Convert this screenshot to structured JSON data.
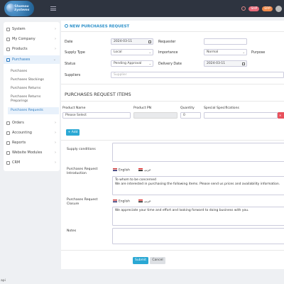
{
  "app": {
    "logo_text": "Shomou Systems",
    "top_pills": [
      "SHP",
      "ERP"
    ]
  },
  "sidebar": {
    "items": [
      {
        "label": "System",
        "icon": "gear-icon"
      },
      {
        "label": "My Company",
        "icon": "building-icon"
      },
      {
        "label": "Products",
        "icon": "box-icon"
      },
      {
        "label": "Purchases",
        "icon": "cart-icon"
      },
      {
        "label": "Orders",
        "icon": "order-icon"
      },
      {
        "label": "Accounting",
        "icon": "calculator-icon"
      },
      {
        "label": "Reports",
        "icon": "report-icon"
      },
      {
        "label": "Website Modules",
        "icon": "globe-icon"
      },
      {
        "label": "CRM",
        "icon": "people-icon"
      }
    ],
    "purchases_sub": [
      "Purchases",
      "Purchases Stockings",
      "Purchases Returns",
      "Purchases Returns Preparings",
      "Purchases Requests"
    ]
  },
  "form": {
    "title": "NEW PURCHASES REQUEST",
    "date_label": "Date",
    "date_value": "2024-03-11",
    "requester_label": "Requester",
    "supply_type_label": "Supply Type",
    "supply_type_value": "Local",
    "importance_label": "Importance",
    "importance_value": "Normal",
    "purpose_label": "Purpose",
    "status_label": "Status",
    "status_value": "Pending Approval",
    "delivery_date_label": "Delivery Date",
    "delivery_date_value": "2024-03-11",
    "suppliers_label": "Suppliers",
    "suppliers_placeholder": "Supplier"
  },
  "items": {
    "title": "PURCHASES REQUEST ITEMS",
    "col_product": "Product Name",
    "col_pn": "Product PN",
    "col_qty": "Quantity",
    "col_spec": "Special Specifications",
    "product_placeholder": "Please Select",
    "qty_value": "0",
    "add_label": "+ Add"
  },
  "sections": {
    "supply_conditions": "Supply conditions",
    "intro_label": "Purchases Request Introduction",
    "intro_lang_en": "English",
    "intro_lang_ar": "عربي",
    "intro_text": "To whom to be concerned\nWe are interested in purchasing the following items. Please send us prices and availability information.",
    "closure_label": "Purchases Request Closure",
    "closure_text": "We appreciate your time and effort and looking forward to doing business with you.",
    "notes_label": "Notes"
  },
  "buttons": {
    "submit": "Submit",
    "cancel": "Cancel"
  },
  "statusbar": {
    "text": "api"
  },
  "colors": {
    "accent": "#2a8fc9",
    "topbar": "#2e3440",
    "danger": "#e8505b"
  }
}
